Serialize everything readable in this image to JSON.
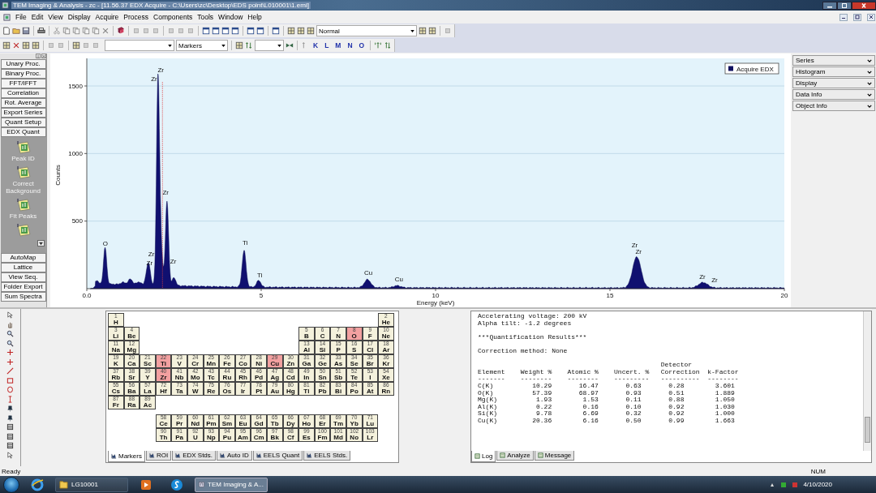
{
  "window": {
    "title": "TEM Imaging & Analysis - zc - [11.56.37 EDX Acquire - C:\\Users\\zc\\Desktop\\EDS point\\L010001\\1.emi]"
  },
  "menu": [
    "File",
    "Edit",
    "View",
    "Display",
    "Acquire",
    "Process",
    "Components",
    "Tools",
    "Window",
    "Help"
  ],
  "toolbar": {
    "mode_select": "Normal",
    "marker_select": "Markers",
    "line_buttons": [
      "K",
      "L",
      "M",
      "N",
      "O"
    ]
  },
  "tools_panel": {
    "top_buttons": [
      "Unary Proc.",
      "Binary Proc.",
      "FFT/IFFT",
      "Correlation",
      "Rot. Average",
      "Export Series",
      "Quant Setup",
      "EDX Quant"
    ],
    "icon_buttons": [
      {
        "kind": "labeled",
        "label": "Peak ID"
      },
      {
        "kind": "labeled",
        "label": "Correct Background"
      },
      {
        "kind": "labeled",
        "label": "Fit Peaks"
      },
      {
        "kind": "icon-only"
      }
    ],
    "bottom_buttons": [
      "AutoMap",
      "Lattice",
      "View Seq.",
      "Folder Export",
      "Sum Spectra"
    ]
  },
  "spectrum": {
    "legend": "Acquire EDX",
    "ylabel": "Counts",
    "xlabel": "Energy (keV)",
    "yticks": [
      "1500",
      "1000",
      "500"
    ],
    "xticks": [
      "0.0",
      "5",
      "10",
      "15",
      "20"
    ],
    "peak_labels": [
      "O",
      "Zr",
      "Zr",
      "Zr",
      "Zr",
      "Zr",
      "Zr",
      "Ti",
      "Ti",
      "Cu",
      "Cu",
      "Zr",
      "Zr",
      "Zr",
      "Zr"
    ]
  },
  "side_panels": [
    "Series",
    "Histogram",
    "Display",
    "Data Info",
    "Object Info"
  ],
  "periodic_table": {
    "elements": [
      {
        "number": "1",
        "symbol": "H",
        "selected": false
      },
      {
        "number": "2",
        "symbol": "He",
        "selected": false
      },
      {
        "number": "3",
        "symbol": "Li",
        "selected": false
      },
      {
        "number": "4",
        "symbol": "Be",
        "selected": false
      },
      {
        "number": "5",
        "symbol": "B",
        "selected": false
      },
      {
        "number": "6",
        "symbol": "C",
        "selected": false
      },
      {
        "number": "7",
        "symbol": "N",
        "selected": false
      },
      {
        "number": "8",
        "symbol": "O",
        "selected": true
      },
      {
        "number": "9",
        "symbol": "F",
        "selected": false
      },
      {
        "number": "10",
        "symbol": "Ne",
        "selected": false
      },
      {
        "number": "11",
        "symbol": "Na",
        "selected": false
      },
      {
        "number": "12",
        "symbol": "Mg",
        "selected": false
      },
      {
        "number": "13",
        "symbol": "Al",
        "selected": false
      },
      {
        "number": "14",
        "symbol": "Si",
        "selected": false
      },
      {
        "number": "15",
        "symbol": "P",
        "selected": false
      },
      {
        "number": "16",
        "symbol": "S",
        "selected": false
      },
      {
        "number": "17",
        "symbol": "Cl",
        "selected": false
      },
      {
        "number": "18",
        "symbol": "Ar",
        "selected": false
      },
      {
        "number": "19",
        "symbol": "K",
        "selected": false
      },
      {
        "number": "20",
        "symbol": "Ca",
        "selected": false
      },
      {
        "number": "21",
        "symbol": "Sc",
        "selected": false
      },
      {
        "number": "22",
        "symbol": "Ti",
        "selected": true
      },
      {
        "number": "23",
        "symbol": "V",
        "selected": false
      },
      {
        "number": "24",
        "symbol": "Cr",
        "selected": false
      },
      {
        "number": "25",
        "symbol": "Mn",
        "selected": false
      },
      {
        "number": "26",
        "symbol": "Fe",
        "selected": false
      },
      {
        "number": "27",
        "symbol": "Co",
        "selected": false
      },
      {
        "number": "28",
        "symbol": "Ni",
        "selected": false
      },
      {
        "number": "29",
        "symbol": "Cu",
        "selected": true
      },
      {
        "number": "30",
        "symbol": "Zn",
        "selected": false
      },
      {
        "number": "31",
        "symbol": "Ga",
        "selected": false
      },
      {
        "number": "32",
        "symbol": "Ge",
        "selected": false
      },
      {
        "number": "33",
        "symbol": "As",
        "selected": false
      },
      {
        "number": "34",
        "symbol": "Se",
        "selected": false
      },
      {
        "number": "35",
        "symbol": "Br",
        "selected": false
      },
      {
        "number": "36",
        "symbol": "Kr",
        "selected": false
      },
      {
        "number": "37",
        "symbol": "Rb",
        "selected": false
      },
      {
        "number": "38",
        "symbol": "Sr",
        "selected": false
      },
      {
        "number": "39",
        "symbol": "Y",
        "selected": false
      },
      {
        "number": "40",
        "symbol": "Zr",
        "selected": true
      },
      {
        "number": "41",
        "symbol": "Nb",
        "selected": false
      },
      {
        "number": "42",
        "symbol": "Mo",
        "selected": false
      },
      {
        "number": "43",
        "symbol": "Tc",
        "selected": false
      },
      {
        "number": "44",
        "symbol": "Ru",
        "selected": false
      },
      {
        "number": "45",
        "symbol": "Rh",
        "selected": false
      },
      {
        "number": "46",
        "symbol": "Pd",
        "selected": false
      },
      {
        "number": "47",
        "symbol": "Ag",
        "selected": false
      },
      {
        "number": "48",
        "symbol": "Cd",
        "selected": false
      },
      {
        "number": "49",
        "symbol": "In",
        "selected": false
      },
      {
        "number": "50",
        "symbol": "Sn",
        "selected": false
      },
      {
        "number": "51",
        "symbol": "Sb",
        "selected": false
      },
      {
        "number": "52",
        "symbol": "Te",
        "selected": false
      },
      {
        "number": "53",
        "symbol": "I",
        "selected": false
      },
      {
        "number": "54",
        "symbol": "Xe",
        "selected": false
      },
      {
        "number": "55",
        "symbol": "Cs",
        "selected": false
      },
      {
        "number": "56",
        "symbol": "Ba",
        "selected": false
      },
      {
        "number": "57",
        "symbol": "La",
        "selected": false
      },
      {
        "number": "72",
        "symbol": "Hf",
        "selected": false
      },
      {
        "number": "73",
        "symbol": "Ta",
        "selected": false
      },
      {
        "number": "74",
        "symbol": "W",
        "selected": false
      },
      {
        "number": "75",
        "symbol": "Re",
        "selected": false
      },
      {
        "number": "76",
        "symbol": "Os",
        "selected": false
      },
      {
        "number": "77",
        "symbol": "Ir",
        "selected": false
      },
      {
        "number": "78",
        "symbol": "Pt",
        "selected": false
      },
      {
        "number": "79",
        "symbol": "Au",
        "selected": false
      },
      {
        "number": "80",
        "symbol": "Hg",
        "selected": false
      },
      {
        "number": "81",
        "symbol": "Tl",
        "selected": false
      },
      {
        "number": "82",
        "symbol": "Pb",
        "selected": false
      },
      {
        "number": "83",
        "symbol": "Bi",
        "selected": false
      },
      {
        "number": "84",
        "symbol": "Po",
        "selected": false
      },
      {
        "number": "85",
        "symbol": "At",
        "selected": false
      },
      {
        "number": "86",
        "symbol": "Rn",
        "selected": false
      },
      {
        "number": "87",
        "symbol": "Fr",
        "selected": false
      },
      {
        "number": "88",
        "symbol": "Ra",
        "selected": false
      },
      {
        "number": "89",
        "symbol": "Ac",
        "selected": false
      },
      {
        "number": "58",
        "symbol": "Ce",
        "selected": false
      },
      {
        "number": "59",
        "symbol": "Pr",
        "selected": false
      },
      {
        "number": "60",
        "symbol": "Nd",
        "selected": false
      },
      {
        "number": "61",
        "symbol": "Pm",
        "selected": false
      },
      {
        "number": "62",
        "symbol": "Sm",
        "selected": false
      },
      {
        "number": "63",
        "symbol": "Eu",
        "selected": false
      },
      {
        "number": "64",
        "symbol": "Gd",
        "selected": false
      },
      {
        "number": "65",
        "symbol": "Tb",
        "selected": false
      },
      {
        "number": "66",
        "symbol": "Dy",
        "selected": false
      },
      {
        "number": "67",
        "symbol": "Ho",
        "selected": false
      },
      {
        "number": "68",
        "symbol": "Er",
        "selected": false
      },
      {
        "number": "69",
        "symbol": "Tm",
        "selected": false
      },
      {
        "number": "70",
        "symbol": "Yb",
        "selected": false
      },
      {
        "number": "71",
        "symbol": "Lu",
        "selected": false
      },
      {
        "number": "90",
        "symbol": "Th",
        "selected": false
      },
      {
        "number": "91",
        "symbol": "Pa",
        "selected": false
      },
      {
        "number": "92",
        "symbol": "U",
        "selected": false
      },
      {
        "number": "93",
        "symbol": "Np",
        "selected": false
      },
      {
        "number": "94",
        "symbol": "Pu",
        "selected": false
      },
      {
        "number": "95",
        "symbol": "Am",
        "selected": false
      },
      {
        "number": "96",
        "symbol": "Cm",
        "selected": false
      },
      {
        "number": "97",
        "symbol": "Bk",
        "selected": false
      },
      {
        "number": "98",
        "symbol": "Cf",
        "selected": false
      },
      {
        "number": "99",
        "symbol": "Es",
        "selected": false
      },
      {
        "number": "100",
        "symbol": "Fm",
        "selected": false
      },
      {
        "number": "101",
        "symbol": "Md",
        "selected": false
      },
      {
        "number": "102",
        "symbol": "No",
        "selected": false
      },
      {
        "number": "103",
        "symbol": "Lr",
        "selected": false
      }
    ],
    "tabs": [
      {
        "label": "Markers",
        "selected": true
      },
      {
        "label": "ROI",
        "selected": false
      },
      {
        "label": "EDX Stds.",
        "selected": false
      },
      {
        "label": "Auto ID",
        "selected": false
      },
      {
        "label": "EELS Quant",
        "selected": false
      },
      {
        "label": "EELS Stds.",
        "selected": false
      }
    ]
  },
  "log": {
    "blocks": [
      [
        "Accelerating voltage: 200 kV",
        "Alpha tilt: -1.2 degrees"
      ],
      [
        "***Quantification Results***"
      ],
      [
        "Correction method: None"
      ],
      [
        "                                               Detector",
        "Element    Weight %    Atomic %    Uncert. %   Correction  k-Factor",
        "-------    --------    --------    ---------   ----------  --------",
        "C(K)          10.29       16.47       0.63       0.28        3.601",
        "O(K)          57.39       68.97       0.93       0.51        1.889",
        "Mg(K)          1.93        1.53       0.11       0.88        1.050",
        "Al(K)          0.22        0.16       0.10       0.92        1.030",
        "Si(K)          9.78        6.69       0.32       0.92        1.000",
        "Cu(K)         20.36        6.16       0.50       0.99        1.663"
      ]
    ],
    "tabs": [
      {
        "label": "Log",
        "selected": true
      },
      {
        "label": "Analyze",
        "selected": false
      },
      {
        "label": "Message",
        "selected": false
      }
    ]
  },
  "status_bar": {
    "text": "Ready",
    "indicator": "NUM"
  },
  "taskbar": {
    "buttons": [
      {
        "kind": "folder",
        "label": "LG10001",
        "selected": false
      },
      {
        "kind": "app",
        "label": "TEM Imaging & A...",
        "selected": true
      }
    ],
    "date": "4/10/2020"
  }
}
